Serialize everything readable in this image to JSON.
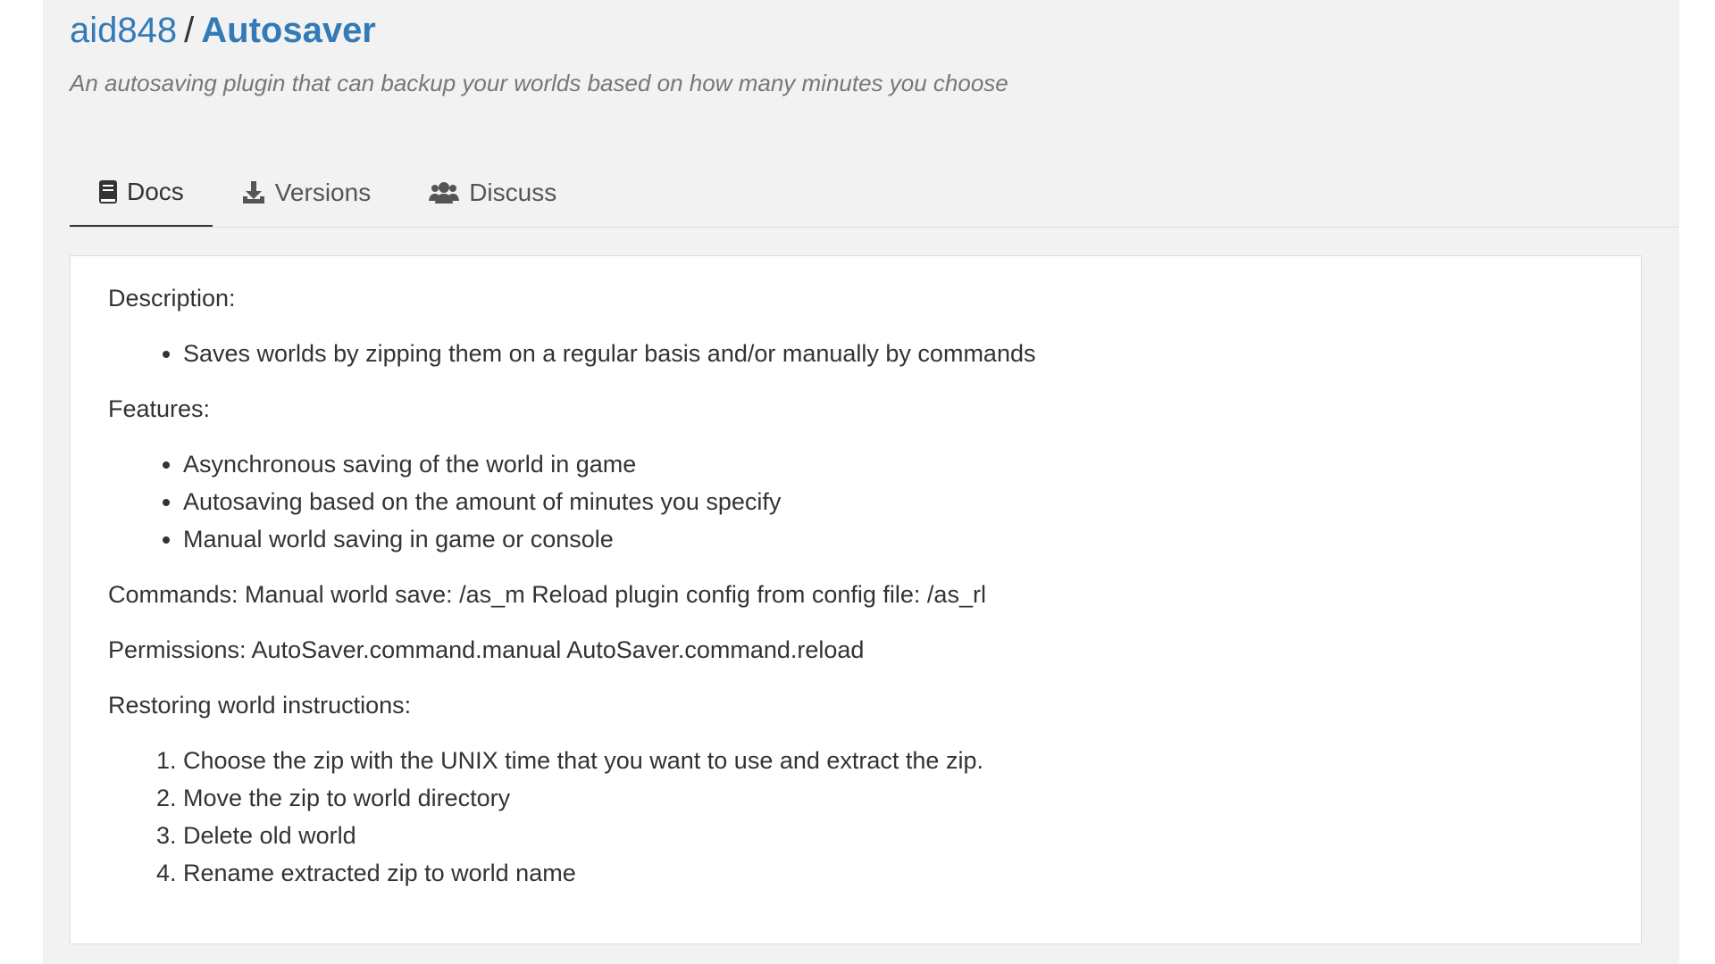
{
  "project": {
    "owner": "aid848",
    "separator": "/",
    "name": "Autosaver",
    "description": "An autosaving plugin that can backup your worlds based on how many minutes you choose"
  },
  "tabs": [
    {
      "label": "Docs",
      "icon": "book-icon",
      "active": true
    },
    {
      "label": "Versions",
      "icon": "download-icon",
      "active": false
    },
    {
      "label": "Discuss",
      "icon": "users-icon",
      "active": false
    }
  ],
  "doc": {
    "description_heading": "Description:",
    "description_items": [
      "Saves worlds by zipping them on a regular basis and/or manually by commands"
    ],
    "features_heading": "Features:",
    "features_items": [
      "Asynchronous saving of the world in game",
      "Autosaving based on the amount of minutes you specify",
      "Manual world saving in game or console"
    ],
    "commands_text": "Commands: Manual world save: /as_m Reload plugin config from config file: /as_rl",
    "permissions_text": "Permissions: AutoSaver.command.manual AutoSaver.command.reload",
    "restoring_heading": "Restoring world instructions:",
    "restoring_steps": [
      "Choose the zip with the UNIX time that you want to use and extract the zip.",
      "Move the zip to world directory",
      "Delete old world",
      "Rename extracted zip to world name"
    ]
  },
  "colors": {
    "link": "#337ab7",
    "background": "#f2f2f2",
    "panel": "#ffffff",
    "text": "#333333",
    "muted": "#777777"
  }
}
